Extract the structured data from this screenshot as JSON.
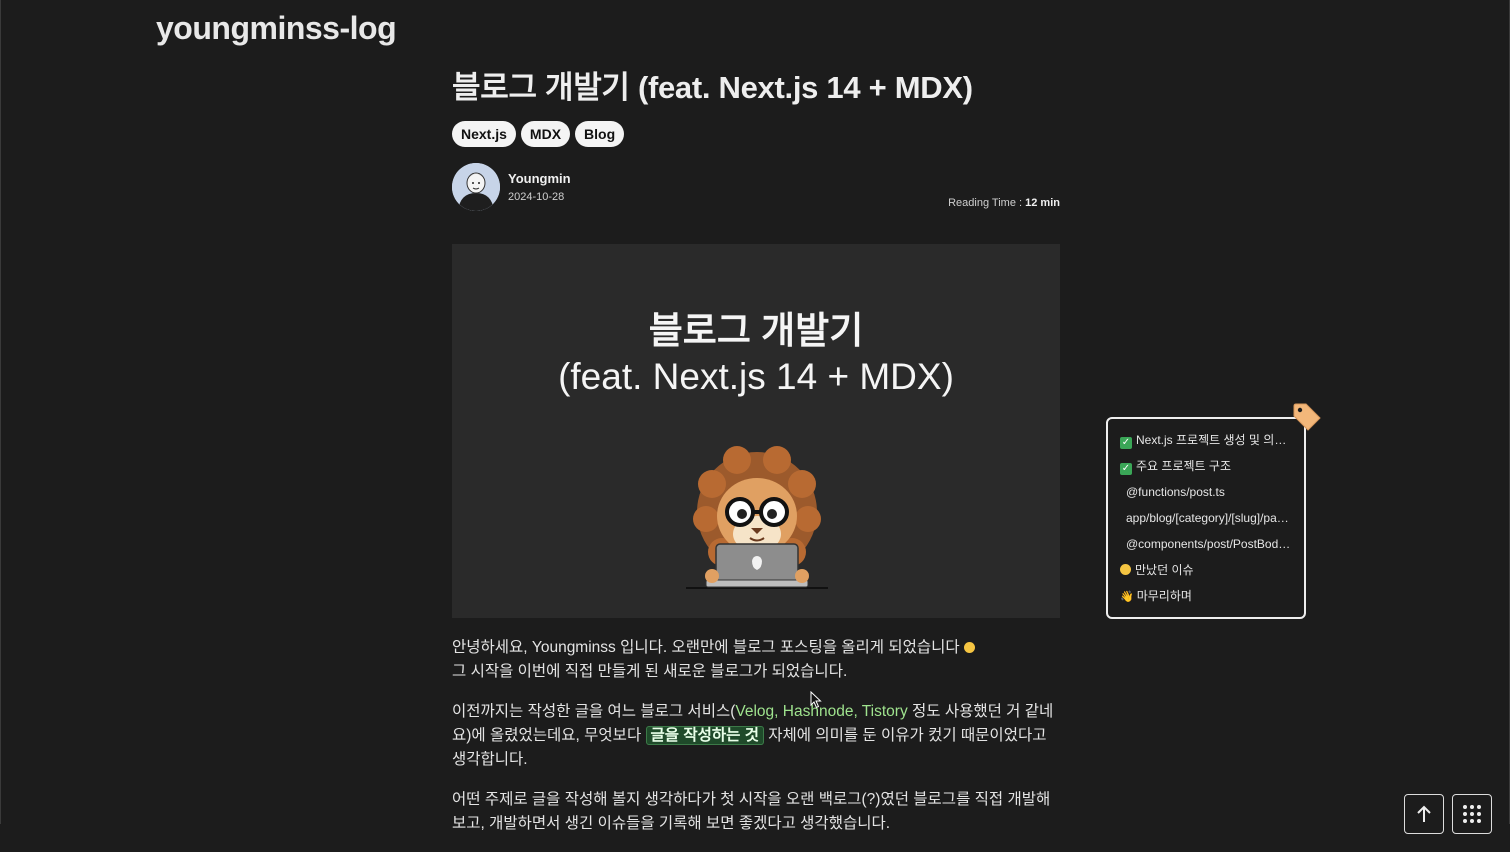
{
  "site": {
    "title": "youngminss-log"
  },
  "post": {
    "title": "블로그 개발기 (feat. Next.js 14 + MDX)",
    "tags": [
      "Next.js",
      "MDX",
      "Blog"
    ],
    "author": "Youngmin",
    "date": "2024-10-28",
    "reading_time_label": "Reading Time : ",
    "reading_time_value": "12 min",
    "cover": {
      "line1": "블로그 개발기",
      "line2": "(feat. Next.js 14 + MDX)"
    },
    "paragraphs": {
      "p1_line1": "안녕하세요, Youngminss 입니다. 오랜만에 블로그 포스팅을 올리게 되었습니다 ",
      "p1_line2": "그 시작을 이번에 직접 만들게 된 새로운 블로그가 되었습니다.",
      "p2_prefix": "이전까지는 작성한 글을 여느 블로그 서비스(",
      "p2_links": "Velog, Hashnode, Tistory",
      "p2_mid": " 정도 사용했던 거 같네요)에 올렸었는데요, 무엇보다 ",
      "p2_highlight": "글을 작성하는 것",
      "p2_suffix": " 자체에 의미를 둔 이유가 컸기 때문이었다고 생각합니다.",
      "p3": "어떤 주제로 글을 작성해 볼지 생각하다가 첫 시작을 오랜 백로그(?)였던 블로그를 직접 개발해 보고, 개발하면서 생긴 이슈들을 기록해 보면 좋겠다고 생각했습니다."
    }
  },
  "toc": {
    "items": [
      {
        "label": "Next.js 프로젝트 생성 및 의존성 설치",
        "icon": "check-icon"
      },
      {
        "label": "주요 프로젝트 구조",
        "icon": "check-icon"
      },
      {
        "label": "@functions/post.ts",
        "icon": ""
      },
      {
        "label": "app/blog/[category]/[slug]/page.tsx",
        "icon": ""
      },
      {
        "label": "@components/post/PostBody.tsx",
        "icon": ""
      },
      {
        "label": "만났던 이슈",
        "icon": "smile-icon"
      },
      {
        "label": "마무리하며",
        "icon": "wave-icon"
      }
    ]
  },
  "colors": {
    "background": "#1c1c1c",
    "link": "#9fe38e",
    "highlight_bg": "#1f4a2a"
  }
}
